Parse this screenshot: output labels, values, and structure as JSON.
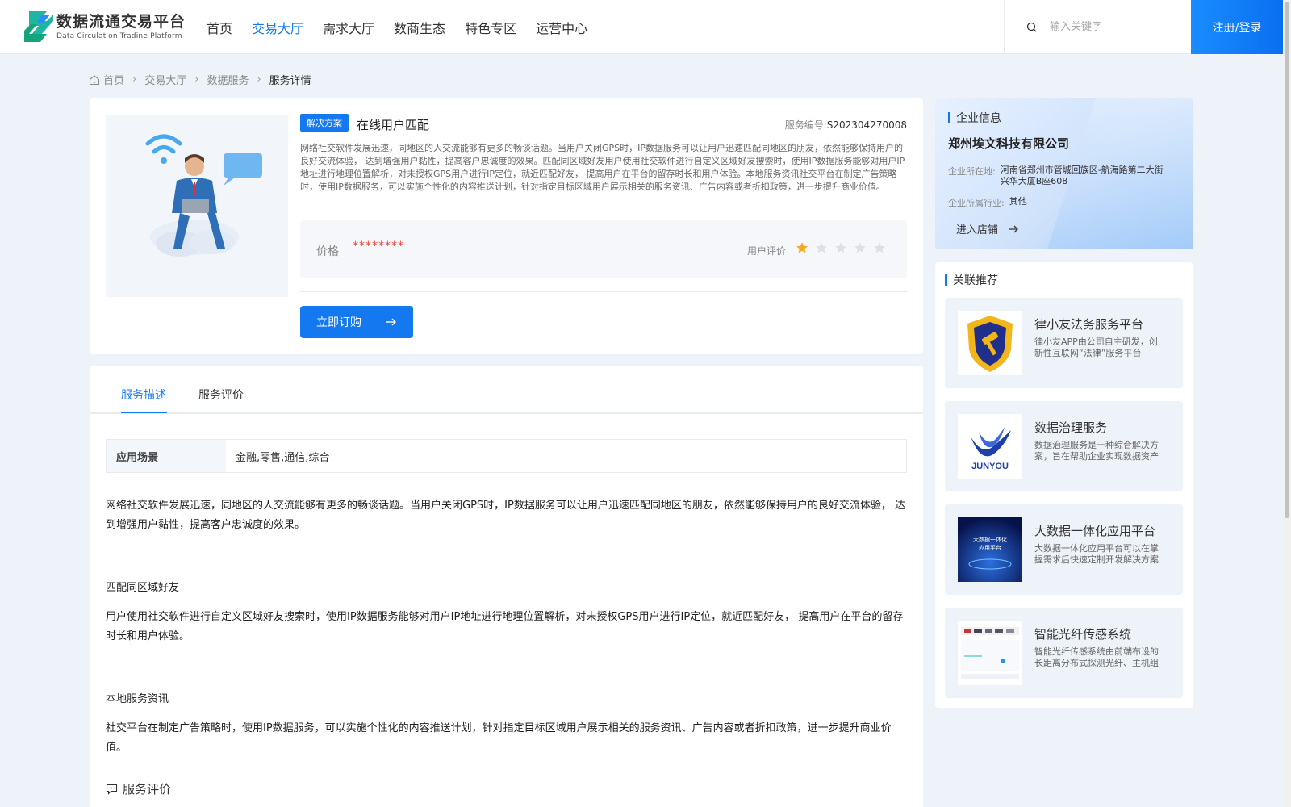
{
  "header": {
    "logo_cn": "数据流通交易平台",
    "logo_en": "Data Circulation Tradine Platform",
    "nav": [
      "首页",
      "交易大厅",
      "需求大厅",
      "数商生态",
      "特色专区",
      "运营中心"
    ],
    "active_nav_index": 1,
    "search_placeholder": "输入关键字",
    "login_label": "注册/登录"
  },
  "breadcrumb": [
    "首页",
    "交易大厅",
    "数据服务",
    "服务详情"
  ],
  "product": {
    "tag": "解决方案",
    "title": "在线用户匹配",
    "service_no_label": "服务编号:",
    "service_no": "S202304270008",
    "description": "网络社交软件发展迅速，同地区的人交流能够有更多的畅谈话题。当用户关闭GPS时，IP数据服务可以让用户迅速匹配同地区的朋友，依然能够保持用户的良好交流体验， 达到增强用户黏性，提高客户忠诚度的效果。匹配同区域好友用户使用社交软件进行自定义区域好友搜索时，使用IP数据服务能够对用户IP地址进行地理位置解析，对未授权GPS用户进行IP定位，就近匹配好友， 提高用户在平台的留存时长和用户体验。本地服务资讯社交平台在制定广告策略时，使用IP数据服务，可以实施个性化的内容推送计划，针对指定目标区域用户展示相关的服务资讯、广告内容或者折扣政策，进一步提升商业价值。",
    "price_label": "价格",
    "price_value": "********",
    "rating_label": "用户评价",
    "rating": 1,
    "rating_max": 5,
    "buy_label": "立即订购"
  },
  "company": {
    "section_title": "企业信息",
    "name": "郑州埃文科技有限公司",
    "location_label": "企业所在地:",
    "location": "河南省郑州市管城回族区-航海路第二大街兴华大厦B座608",
    "industry_label": "企业所属行业:",
    "industry": "其他",
    "shop_label": "进入店铺"
  },
  "related": {
    "section_title": "关联推荐",
    "items": [
      {
        "title": "律小友法务服务平台",
        "desc": "律小友APP由公司自主研发，创新性互联网“法律”服务平台"
      },
      {
        "title": "数据治理服务",
        "desc": "数据治理服务是一种综合解决方案，旨在帮助企业实现数据资产管理"
      },
      {
        "title": "大数据一体化应用平台",
        "desc": "大数据一体化应用平台可以在掌握需求后快速定制开发解决方案"
      },
      {
        "title": "智能光纤传感系统",
        "desc": "智能光纤传感系统由前端布设的长距离分布式探测光纤、主机组成"
      }
    ],
    "logo2_text": "JUNYOU",
    "img3_line1": "大数据一体化",
    "img3_line2": "应用平台"
  },
  "detail": {
    "tabs": [
      "服务描述",
      "服务评价"
    ],
    "active_tab_index": 0,
    "scene_label": "应用场景",
    "scene_value": "金融,零售,通信,综合",
    "p1": "网络社交软件发展迅速，同地区的人交流能够有更多的畅谈话题。当用户关闭GPS时，IP数据服务可以让用户迅速匹配同地区的朋友，依然能够保持用户的良好交流体验， 达到增强用户黏性，提高客户忠诚度的效果。",
    "h2": "匹配同区域好友",
    "p2": "用户使用社交软件进行自定义区域好友搜索时，使用IP数据服务能够对用户IP地址进行地理位置解析，对未授权GPS用户进行IP定位，就近匹配好友， 提高用户在平台的留存时长和用户体验。",
    "h3": "本地服务资讯",
    "p3": "社交平台在制定广告策略时，使用IP数据服务，可以实施个性化的内容推送计划，针对指定目标区域用户展示相关的服务资讯、广告内容或者折扣政策，进一步提升商业价值。",
    "review_title": "服务评价"
  },
  "colors": {
    "accent": "#1478f0",
    "price": "#e8453c",
    "star": "#f5a623",
    "star_empty": "#e0e0e0"
  }
}
